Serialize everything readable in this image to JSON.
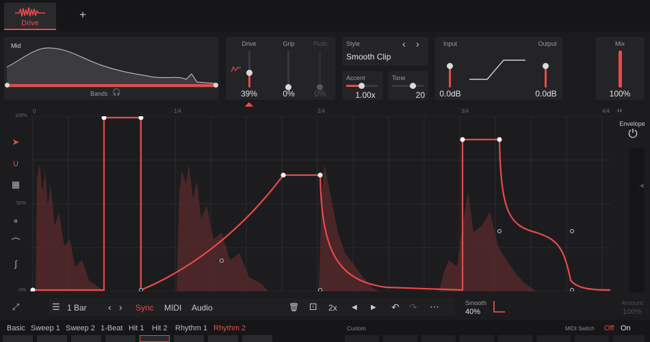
{
  "tabs": [
    {
      "label": "Drive"
    }
  ],
  "add_tab": "+",
  "band_display": {
    "mid_label": "Mid",
    "bands_label": "Bands"
  },
  "drive": {
    "label": "Drive",
    "value": "39%",
    "level": 0.39
  },
  "grip": {
    "label": "Grip",
    "value": "0%",
    "level": 0.0
  },
  "push": {
    "label": "Push",
    "value": "0%",
    "level": 0.0
  },
  "style": {
    "label": "Style",
    "value": "Smooth Clip",
    "prev": "‹",
    "next": "›"
  },
  "accent": {
    "label": "Accent",
    "value": "1.00x"
  },
  "tone": {
    "label": "Tone",
    "value": "20"
  },
  "input": {
    "label": "Input",
    "value": "0.0dB",
    "level": 0.5
  },
  "output": {
    "label": "Output",
    "value": "0.0dB",
    "level": 0.5
  },
  "mix": {
    "label": "Mix",
    "value": "100%",
    "level": 1.0
  },
  "timeline": {
    "t0": "0",
    "t1": "1/4",
    "t2": "2/4",
    "t3": "3/4",
    "t4": "4/4"
  },
  "yaxis": {
    "top": "100%",
    "mid": "50%",
    "bottom": "0%"
  },
  "envelope_panel": {
    "label": "Envelope",
    "amount_label": "Amount",
    "amount_value": "100%",
    "collapse": "‹‹"
  },
  "toolbar": {
    "length": "1 Bar",
    "prev": "‹",
    "next": "›",
    "modes": [
      "Sync",
      "MIDI",
      "Audio"
    ],
    "active_mode": "Sync",
    "multiplier": "2x",
    "smooth_label": "Smooth",
    "smooth_value": "40%"
  },
  "presets": {
    "items": [
      "Basic",
      "Sweep 1",
      "Sweep 2",
      "1-Beat",
      "Hit 1",
      "Hit 2",
      "Rhythm 1",
      "Rhythm 2"
    ],
    "active": "Rhythm 2",
    "custom_label": "Custom",
    "midi_switch_label": "MIDI Switch",
    "midi_off": "Off",
    "midi_on": "On"
  },
  "colors": {
    "accent": "#e84a4a",
    "bg": "#1b1b1d",
    "panel": "#242427"
  }
}
